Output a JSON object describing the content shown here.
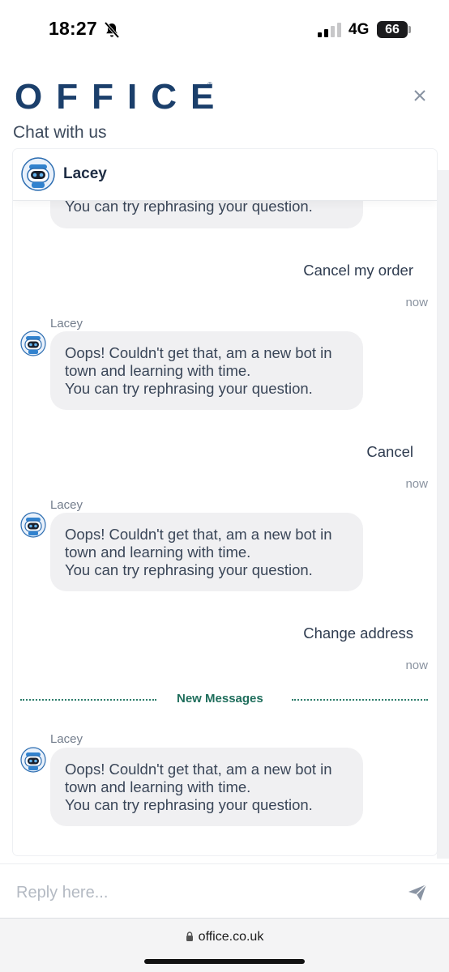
{
  "status_bar": {
    "time": "18:27",
    "network": "4G",
    "battery": "66"
  },
  "header": {
    "brand": "OFFICE",
    "brand_mark": "®",
    "subtitle": "Chat with us",
    "close_icon": "close-icon"
  },
  "agent": {
    "name": "Lacey"
  },
  "messages": [
    {
      "type": "bot",
      "lines": [
        "You can try rephrasing your question."
      ]
    },
    {
      "type": "user",
      "text": "Cancel my order",
      "time": "now"
    },
    {
      "type": "bot",
      "sender": "Lacey",
      "lines": [
        "Oops! Couldn't get that, am a new bot in",
        "town and learning with time.",
        "You can try rephrasing your question."
      ]
    },
    {
      "type": "user",
      "text": "Cancel",
      "time": "now"
    },
    {
      "type": "bot",
      "sender": "Lacey",
      "lines": [
        "Oops! Couldn't get that, am a new bot in",
        "town and learning with time.",
        "You can try rephrasing your question."
      ]
    },
    {
      "type": "user",
      "text": "Change address",
      "time": "now"
    },
    {
      "type": "divider",
      "text": "New Messages"
    },
    {
      "type": "bot",
      "sender": "Lacey",
      "lines": [
        "Oops! Couldn't get that, am a new bot in",
        "town and learning with time.",
        "You can try rephrasing your question."
      ]
    }
  ],
  "reply": {
    "placeholder": "Reply here...",
    "send_icon": "send-icon"
  },
  "browser": {
    "url": "office.co.uk"
  },
  "colors": {
    "brand": "#1b3f6b",
    "divider": "#1f6e5c",
    "bubble": "#f0f0f2"
  }
}
